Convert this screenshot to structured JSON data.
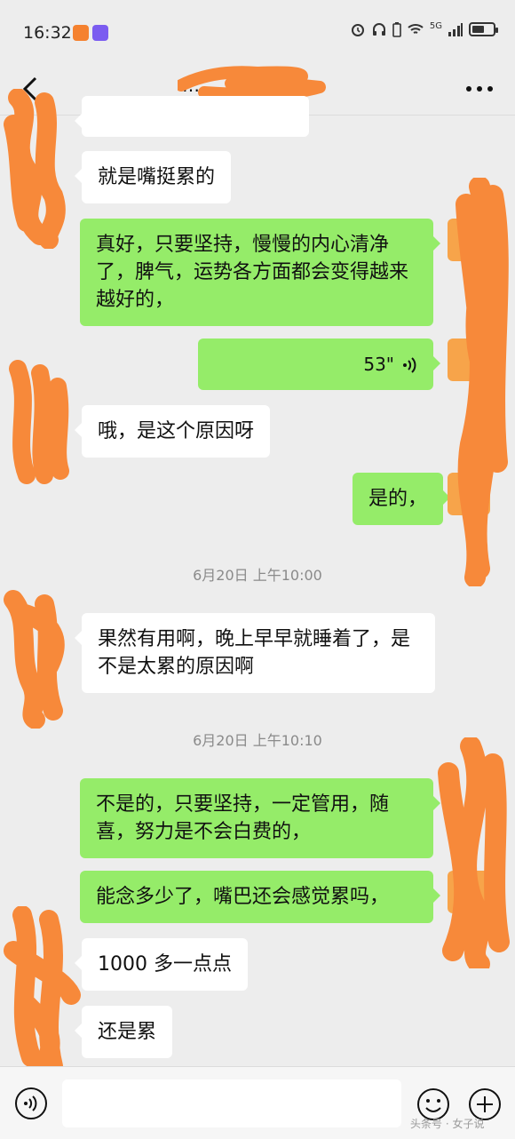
{
  "status_bar": {
    "time": "16:32",
    "network": "5G",
    "icons": [
      "taobao-icon",
      "tieba-icon",
      "alarm-icon",
      "headphones-icon",
      "battery-small-icon",
      "wifi-icon",
      "signal-icon",
      "battery-icon"
    ],
    "battery_level": 0.6,
    "colors": {
      "taobao": "#f5812f",
      "tieba": "#7b5cf0"
    }
  },
  "nav": {
    "back_icon": "chevron-left-icon",
    "title": "…",
    "more_icon": "more-dots-icon"
  },
  "messages": [
    {
      "side": "in",
      "text": "就是嘴挺累的"
    },
    {
      "side": "out",
      "text": "真好，只要坚持，慢慢的内心清净了，脾气，运势各方面都会变得越来越好的，"
    },
    {
      "side": "out",
      "type": "voice",
      "duration": "53\""
    },
    {
      "side": "in",
      "text": "哦，是这个原因呀"
    },
    {
      "side": "out",
      "text": "是的，"
    },
    {
      "type": "time",
      "text": "6月20日 上午10:00"
    },
    {
      "side": "in",
      "text": "果然有用啊，晚上早早就睡着了，是不是太累的原因啊"
    },
    {
      "type": "time",
      "text": "6月20日 上午10:10"
    },
    {
      "side": "out",
      "text": "不是的，只要坚持，一定管用，随喜，努力是不会白费的，"
    },
    {
      "side": "out",
      "text": "能念多少了，嘴巴还会感觉累吗，"
    },
    {
      "side": "in",
      "text": "1000 多一点点"
    },
    {
      "side": "in",
      "text": "还是累"
    }
  ],
  "input_bar": {
    "voice_icon": "voice-input-icon",
    "input_value": "",
    "emoji_icon": "emoji-icon",
    "plus_icon": "plus-icon"
  },
  "colors": {
    "background": "#ededed",
    "bubble_out": "#95ec69",
    "bubble_in": "#ffffff",
    "scribble": "#f7893a"
  },
  "watermark": "头条号 · 女子说"
}
